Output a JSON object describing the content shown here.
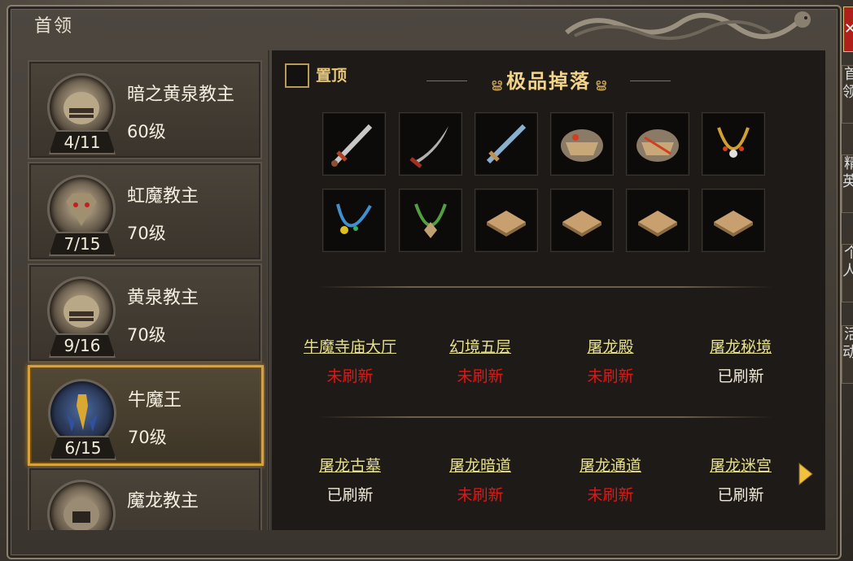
{
  "window": {
    "title": "首领",
    "close_icon": "close-icon"
  },
  "side_tabs": [
    "首领",
    "精英",
    "个人",
    "活动"
  ],
  "bosses": [
    {
      "name": "暗之黄泉教主",
      "level": "60级",
      "count": "4/11",
      "selected": false
    },
    {
      "name": "虹魔教主",
      "level": "70级",
      "count": "7/15",
      "selected": false
    },
    {
      "name": "黄泉教主",
      "level": "70级",
      "count": "9/16",
      "selected": false
    },
    {
      "name": "牛魔王",
      "level": "70级",
      "count": "6/15",
      "selected": true
    },
    {
      "name": "魔龙教主",
      "level": "",
      "count": "",
      "selected": false
    }
  ],
  "pin": {
    "label": "置顶",
    "checked": false
  },
  "drops": {
    "title": "极品掉落",
    "items": [
      "sword-icon",
      "scimitar-icon",
      "blue-sword-icon",
      "armor-icon",
      "armor-icon",
      "necklace-icon",
      "necklace-icon",
      "necklace-icon",
      "scroll-icon",
      "scroll-icon",
      "scroll-icon",
      "scroll-icon"
    ]
  },
  "maps": [
    {
      "name": "牛魔寺庙大厅",
      "status": "未刷新",
      "refreshed": false
    },
    {
      "name": "幻境五层",
      "status": "未刷新",
      "refreshed": false
    },
    {
      "name": "屠龙殿",
      "status": "未刷新",
      "refreshed": false
    },
    {
      "name": "屠龙秘境",
      "status": "已刷新",
      "refreshed": true
    },
    {
      "name": "屠龙古墓",
      "status": "已刷新",
      "refreshed": true
    },
    {
      "name": "屠龙暗道",
      "status": "未刷新",
      "refreshed": false
    },
    {
      "name": "屠龙通道",
      "status": "未刷新",
      "refreshed": false
    },
    {
      "name": "屠龙迷宫",
      "status": "已刷新",
      "refreshed": true
    }
  ],
  "colors": {
    "refreshed": "#f0ead8",
    "not_refreshed": "#e01818",
    "accent_gold": "#d6a23a"
  }
}
